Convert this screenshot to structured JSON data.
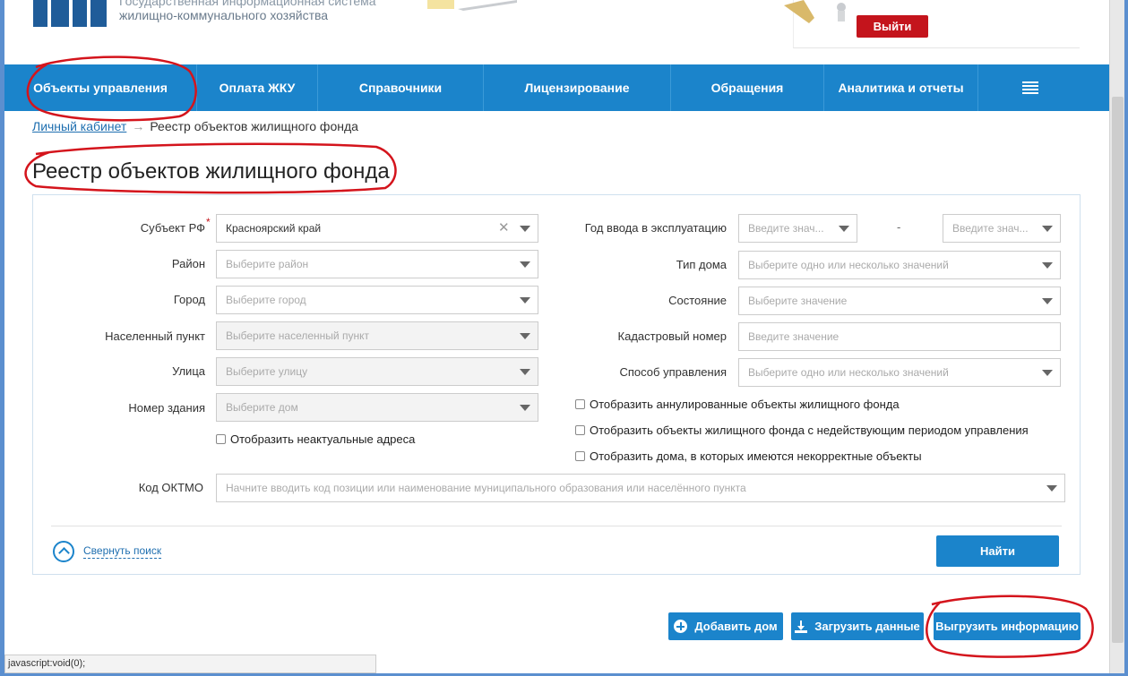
{
  "header": {
    "system_title_line1": "Государственная информационная система",
    "system_title_line2": "жилищно-коммунального хозяйства",
    "logout_label": "Выйти"
  },
  "nav": {
    "items": [
      {
        "label": "Объекты управления"
      },
      {
        "label": "Оплата ЖКУ"
      },
      {
        "label": "Справочники"
      },
      {
        "label": "Лицензирование"
      },
      {
        "label": "Обращения"
      },
      {
        "label": "Аналитика и отчеты"
      }
    ],
    "menu_icon": "hamburger-icon"
  },
  "breadcrumb": {
    "link": "Личный кабинет",
    "arrow": "→",
    "current": "Реестр объектов жилищного фонда"
  },
  "page_title": "Реестр объектов жилищного фонда",
  "filters": {
    "subject": {
      "label": "Субъект РФ",
      "required_mark": "*",
      "value": "Красноярский край"
    },
    "district": {
      "label": "Район",
      "placeholder": "Выберите район"
    },
    "city": {
      "label": "Город",
      "placeholder": "Выберите город"
    },
    "settlement": {
      "label": "Населенный пункт",
      "placeholder": "Выберите населенный пункт"
    },
    "street": {
      "label": "Улица",
      "placeholder": "Выберите улицу"
    },
    "building": {
      "label": "Номер здания",
      "placeholder": "Выберите дом"
    },
    "show_outdated": {
      "label": "Отобразить неактуальные адреса",
      "checked": false
    },
    "year": {
      "label": "Год ввода в эксплуатацию",
      "from_placeholder": "Введите знач...",
      "dash": "-",
      "to_placeholder": "Введите знач..."
    },
    "house_type": {
      "label": "Тип дома",
      "placeholder": "Выберите одно или несколько значений"
    },
    "state": {
      "label": "Состояние",
      "placeholder": "Выберите значение"
    },
    "cadastral": {
      "label": "Кадастровый номер",
      "placeholder": "Введите значение"
    },
    "management": {
      "label": "Способ управления",
      "placeholder": "Выберите одно или несколько значений"
    },
    "show_annulled": {
      "label": "Отобразить аннулированные объекты жилищного фонда",
      "checked": false
    },
    "show_inactive_period": {
      "label": "Отобразить объекты жилищного фонда с недействующим периодом управления",
      "checked": false
    },
    "show_incorrect": {
      "label": "Отобразить дома, в которых имеются некорректные объекты",
      "checked": false
    },
    "oktmo": {
      "label": "Код ОКТМО",
      "placeholder": "Начните вводить код позиции или наименование муниципального образования или населённого пункта"
    },
    "collapse_label": "Свернуть поиск",
    "find_label": "Найти"
  },
  "actions": {
    "add_house": "Добавить дом",
    "upload_data": "Загрузить данные",
    "export_info": "Выгрузить информацию"
  },
  "status_bar": "javascript:void(0);",
  "colors": {
    "nav_blue": "#1b84cb",
    "logout_red": "#c4141c",
    "annotation_red": "#d4141c"
  }
}
